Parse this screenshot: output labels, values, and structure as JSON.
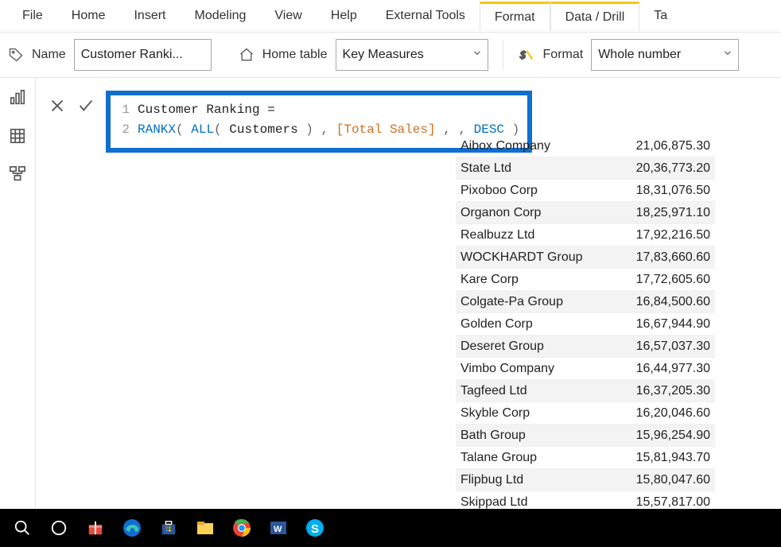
{
  "ribbon": {
    "tabs": [
      "File",
      "Home",
      "Insert",
      "Modeling",
      "View",
      "Help",
      "External Tools",
      "Format",
      "Data / Drill",
      "Ta"
    ],
    "active": "Format"
  },
  "toolbar": {
    "name_label": "Name",
    "name_value": "Customer Ranki...",
    "home_table_label": "Home table",
    "home_table_value": "Key Measures",
    "format_label": "Format",
    "format_value": "Whole number"
  },
  "formula": {
    "line1": "Customer Ranking =",
    "line2_tokens": {
      "fn": "RANKX",
      "open": "(",
      "all": "ALL",
      "open2": "(",
      "tbl": "Customers",
      "close2": ")",
      "comma1": ",",
      "meas": "[Total Sales]",
      "comma2": ",",
      "comma3": ",",
      "desc": "DESC",
      "close": ")"
    }
  },
  "table": [
    {
      "name": "Aibox Company",
      "val": "21,06,875.30"
    },
    {
      "name": "State Ltd",
      "val": "20,36,773.20"
    },
    {
      "name": "Pixoboo Corp",
      "val": "18,31,076.50"
    },
    {
      "name": "Organon Corp",
      "val": "18,25,971.10"
    },
    {
      "name": "Realbuzz Ltd",
      "val": "17,92,216.50"
    },
    {
      "name": "WOCKHARDT Group",
      "val": "17,83,660.60"
    },
    {
      "name": "Kare Corp",
      "val": "17,72,605.60"
    },
    {
      "name": "Colgate-Pa Group",
      "val": "16,84,500.60"
    },
    {
      "name": "Golden Corp",
      "val": "16,67,944.90"
    },
    {
      "name": "Deseret Group",
      "val": "16,57,037.30"
    },
    {
      "name": "Vimbo Company",
      "val": "16,44,977.30"
    },
    {
      "name": "Tagfeed Ltd",
      "val": "16,37,205.30"
    },
    {
      "name": "Skyble Corp",
      "val": "16,20,046.60"
    },
    {
      "name": "Bath Group",
      "val": "15,96,254.90"
    },
    {
      "name": "Talane Group",
      "val": "15,81,943.70"
    },
    {
      "name": "Flipbug Ltd",
      "val": "15,80,047.60"
    },
    {
      "name": "Skippad Ltd",
      "val": "15,57,817.00"
    }
  ]
}
